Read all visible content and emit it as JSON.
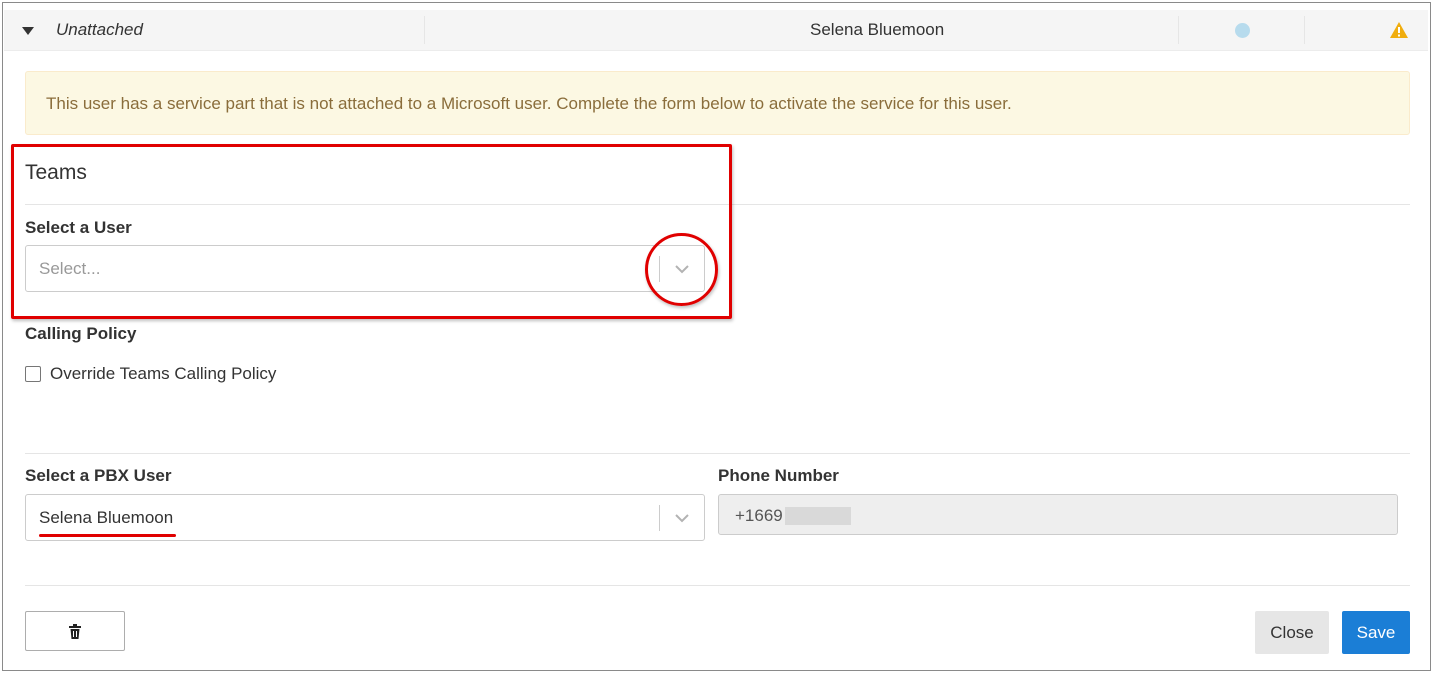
{
  "row": {
    "status": "Unattached",
    "user_name": "Selena Bluemoon",
    "status_dot_color": "#b7dbed",
    "warning_color": "#f0ad0e"
  },
  "alert": {
    "text": "This user has a service part that is not attached to a Microsoft user. Complete the form below to activate the service for this user."
  },
  "teams": {
    "title": "Teams",
    "select_user_label": "Select a User",
    "select_user_placeholder": "Select..."
  },
  "calling_policy": {
    "label": "Calling Policy",
    "override_label": "Override Teams Calling Policy",
    "override_checked": false
  },
  "pbx": {
    "label": "Select a PBX User",
    "value": "Selena Bluemoon"
  },
  "phone": {
    "label": "Phone Number",
    "value": "+1669"
  },
  "buttons": {
    "delete_icon": "trash-icon",
    "close_label": "Close",
    "save_label": "Save"
  },
  "colors": {
    "primary": "#1b7ed6",
    "annotation": "#e00000",
    "alert_bg": "#fcf8e3",
    "alert_text": "#8a6d3b"
  }
}
